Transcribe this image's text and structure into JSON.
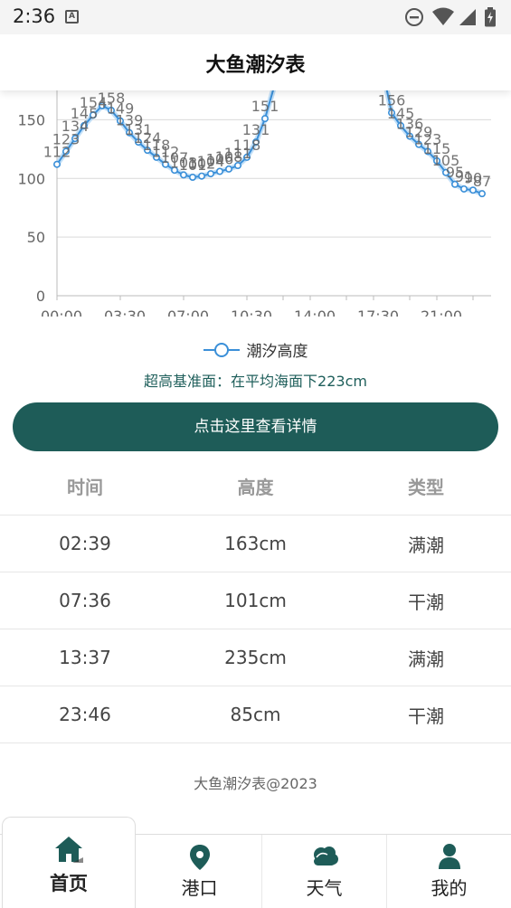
{
  "status_bar": {
    "time": "2:36",
    "a_icon": "A"
  },
  "header": {
    "title": "大鱼潮汐表"
  },
  "chart_data": {
    "type": "line",
    "x_ticks": [
      "00:00",
      "03:30",
      "07:00",
      "10:30",
      "14:00",
      "17:30",
      "21:00"
    ],
    "ylim": [
      0,
      175
    ],
    "y_ticks": [
      0,
      50,
      100,
      150
    ],
    "grid": true,
    "legend_position": "bottom",
    "series": [
      {
        "name": "潮汐高度",
        "color": "#3a8fd8",
        "segments": [
          [
            {
              "x": 0.0,
              "y": 112
            },
            {
              "x": 0.5,
              "y": 123
            },
            {
              "x": 1.0,
              "y": 134
            },
            {
              "x": 1.5,
              "y": 145
            },
            {
              "x": 2.0,
              "y": 154
            },
            {
              "x": 2.5,
              "y": 162
            },
            {
              "x": 3.0,
              "y": 158
            },
            {
              "x": 3.5,
              "y": 149
            },
            {
              "x": 4.0,
              "y": 139
            },
            {
              "x": 4.5,
              "y": 131
            },
            {
              "x": 5.0,
              "y": 124
            },
            {
              "x": 5.5,
              "y": 118
            },
            {
              "x": 6.0,
              "y": 112
            },
            {
              "x": 6.5,
              "y": 107
            },
            {
              "x": 7.0,
              "y": 103
            },
            {
              "x": 7.5,
              "y": 101
            },
            {
              "x": 8.0,
              "y": 102
            },
            {
              "x": 8.5,
              "y": 104
            },
            {
              "x": 9.0,
              "y": 106
            },
            {
              "x": 9.5,
              "y": 108
            },
            {
              "x": 10.0,
              "y": 111
            },
            {
              "x": 10.5,
              "y": 118
            },
            {
              "x": 11.0,
              "y": 131
            },
            {
              "x": 11.5,
              "y": 151
            },
            {
              "x": 12.0,
              "y": 178
            }
          ],
          [
            {
              "x": 18.2,
              "y": 178
            },
            {
              "x": 18.5,
              "y": 156
            },
            {
              "x": 19.0,
              "y": 145
            },
            {
              "x": 19.5,
              "y": 136
            },
            {
              "x": 20.0,
              "y": 129
            },
            {
              "x": 20.5,
              "y": 123
            },
            {
              "x": 21.0,
              "y": 115
            },
            {
              "x": 21.5,
              "y": 105
            },
            {
              "x": 22.0,
              "y": 95
            },
            {
              "x": 22.5,
              "y": 91
            },
            {
              "x": 23.0,
              "y": 90
            },
            {
              "x": 23.5,
              "y": 87
            }
          ]
        ],
        "data_labels": [
          {
            "x": 0.0,
            "y": 112,
            "text": "112"
          },
          {
            "x": 0.5,
            "y": 123,
            "text": "123"
          },
          {
            "x": 1.0,
            "y": 134,
            "text": "134"
          },
          {
            "x": 1.5,
            "y": 145,
            "text": "145"
          },
          {
            "x": 2.0,
            "y": 154,
            "text": "154"
          },
          {
            "x": 3.0,
            "y": 158,
            "text": "158"
          },
          {
            "x": 3.5,
            "y": 149,
            "text": "149"
          },
          {
            "x": 4.0,
            "y": 139,
            "text": "139"
          },
          {
            "x": 4.5,
            "y": 131,
            "text": "131"
          },
          {
            "x": 5.0,
            "y": 124,
            "text": "124"
          },
          {
            "x": 5.5,
            "y": 118,
            "text": "118"
          },
          {
            "x": 6.0,
            "y": 112,
            "text": "112"
          },
          {
            "x": 6.5,
            "y": 107,
            "text": "107"
          },
          {
            "x": 7.0,
            "y": 103,
            "text": "103"
          },
          {
            "x": 7.5,
            "y": 101,
            "text": "101"
          },
          {
            "x": 8.0,
            "y": 102,
            "text": "102"
          },
          {
            "x": 8.5,
            "y": 104,
            "text": "104"
          },
          {
            "x": 9.0,
            "y": 106,
            "text": "106"
          },
          {
            "x": 9.5,
            "y": 108,
            "text": "108"
          },
          {
            "x": 10.0,
            "y": 111,
            "text": "111"
          },
          {
            "x": 10.5,
            "y": 118,
            "text": "118"
          },
          {
            "x": 11.0,
            "y": 131,
            "text": "131"
          },
          {
            "x": 11.5,
            "y": 151,
            "text": "151"
          },
          {
            "x": 18.5,
            "y": 156,
            "text": "156"
          },
          {
            "x": 19.0,
            "y": 145,
            "text": "145"
          },
          {
            "x": 19.5,
            "y": 136,
            "text": "136"
          },
          {
            "x": 20.0,
            "y": 129,
            "text": "129"
          },
          {
            "x": 20.5,
            "y": 123,
            "text": "123"
          },
          {
            "x": 21.0,
            "y": 115,
            "text": "115"
          },
          {
            "x": 21.5,
            "y": 105,
            "text": "105"
          },
          {
            "x": 22.0,
            "y": 95,
            "text": "95"
          },
          {
            "x": 22.5,
            "y": 91,
            "text": "91"
          },
          {
            "x": 23.0,
            "y": 90,
            "text": "90"
          },
          {
            "x": 23.5,
            "y": 87,
            "text": "87"
          }
        ]
      }
    ]
  },
  "legend": {
    "label": "潮汐高度"
  },
  "datum_note": "超高基准面：在平均海面下223cm",
  "detail_button": {
    "label": "点击这里查看详情"
  },
  "table": {
    "headers": [
      "时间",
      "高度",
      "类型"
    ],
    "rows": [
      [
        "02:39",
        "163cm",
        "满潮"
      ],
      [
        "07:36",
        "101cm",
        "干潮"
      ],
      [
        "13:37",
        "235cm",
        "满潮"
      ],
      [
        "23:46",
        "85cm",
        "干潮"
      ]
    ]
  },
  "footer": {
    "copyright": "大鱼潮汐表@2023"
  },
  "bottom_nav": {
    "active": "home",
    "tabs": [
      {
        "id": "home",
        "label": "首页",
        "icon": "home-icon"
      },
      {
        "id": "port",
        "label": "港口",
        "icon": "location-pin-icon"
      },
      {
        "id": "weather",
        "label": "天气",
        "icon": "cloud-icon"
      },
      {
        "id": "mine",
        "label": "我的",
        "icon": "user-icon"
      }
    ]
  },
  "colors": {
    "accent": "#1e5c58",
    "line": "#3a8fd8",
    "text_dark": "#222222"
  }
}
